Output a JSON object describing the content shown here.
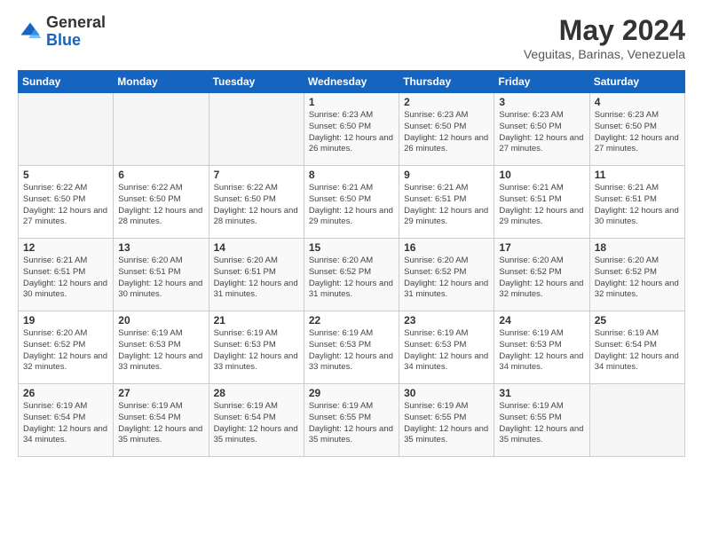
{
  "header": {
    "logo_general": "General",
    "logo_blue": "Blue",
    "title": "May 2024",
    "location": "Veguitas, Barinas, Venezuela"
  },
  "days_of_week": [
    "Sunday",
    "Monday",
    "Tuesday",
    "Wednesday",
    "Thursday",
    "Friday",
    "Saturday"
  ],
  "weeks": [
    [
      {
        "day": "",
        "info": ""
      },
      {
        "day": "",
        "info": ""
      },
      {
        "day": "",
        "info": ""
      },
      {
        "day": "1",
        "info": "Sunrise: 6:23 AM\nSunset: 6:50 PM\nDaylight: 12 hours\nand 26 minutes."
      },
      {
        "day": "2",
        "info": "Sunrise: 6:23 AM\nSunset: 6:50 PM\nDaylight: 12 hours\nand 26 minutes."
      },
      {
        "day": "3",
        "info": "Sunrise: 6:23 AM\nSunset: 6:50 PM\nDaylight: 12 hours\nand 27 minutes."
      },
      {
        "day": "4",
        "info": "Sunrise: 6:23 AM\nSunset: 6:50 PM\nDaylight: 12 hours\nand 27 minutes."
      }
    ],
    [
      {
        "day": "5",
        "info": "Sunrise: 6:22 AM\nSunset: 6:50 PM\nDaylight: 12 hours\nand 27 minutes."
      },
      {
        "day": "6",
        "info": "Sunrise: 6:22 AM\nSunset: 6:50 PM\nDaylight: 12 hours\nand 28 minutes."
      },
      {
        "day": "7",
        "info": "Sunrise: 6:22 AM\nSunset: 6:50 PM\nDaylight: 12 hours\nand 28 minutes."
      },
      {
        "day": "8",
        "info": "Sunrise: 6:21 AM\nSunset: 6:50 PM\nDaylight: 12 hours\nand 29 minutes."
      },
      {
        "day": "9",
        "info": "Sunrise: 6:21 AM\nSunset: 6:51 PM\nDaylight: 12 hours\nand 29 minutes."
      },
      {
        "day": "10",
        "info": "Sunrise: 6:21 AM\nSunset: 6:51 PM\nDaylight: 12 hours\nand 29 minutes."
      },
      {
        "day": "11",
        "info": "Sunrise: 6:21 AM\nSunset: 6:51 PM\nDaylight: 12 hours\nand 30 minutes."
      }
    ],
    [
      {
        "day": "12",
        "info": "Sunrise: 6:21 AM\nSunset: 6:51 PM\nDaylight: 12 hours\nand 30 minutes."
      },
      {
        "day": "13",
        "info": "Sunrise: 6:20 AM\nSunset: 6:51 PM\nDaylight: 12 hours\nand 30 minutes."
      },
      {
        "day": "14",
        "info": "Sunrise: 6:20 AM\nSunset: 6:51 PM\nDaylight: 12 hours\nand 31 minutes."
      },
      {
        "day": "15",
        "info": "Sunrise: 6:20 AM\nSunset: 6:52 PM\nDaylight: 12 hours\nand 31 minutes."
      },
      {
        "day": "16",
        "info": "Sunrise: 6:20 AM\nSunset: 6:52 PM\nDaylight: 12 hours\nand 31 minutes."
      },
      {
        "day": "17",
        "info": "Sunrise: 6:20 AM\nSunset: 6:52 PM\nDaylight: 12 hours\nand 32 minutes."
      },
      {
        "day": "18",
        "info": "Sunrise: 6:20 AM\nSunset: 6:52 PM\nDaylight: 12 hours\nand 32 minutes."
      }
    ],
    [
      {
        "day": "19",
        "info": "Sunrise: 6:20 AM\nSunset: 6:52 PM\nDaylight: 12 hours\nand 32 minutes."
      },
      {
        "day": "20",
        "info": "Sunrise: 6:19 AM\nSunset: 6:53 PM\nDaylight: 12 hours\nand 33 minutes."
      },
      {
        "day": "21",
        "info": "Sunrise: 6:19 AM\nSunset: 6:53 PM\nDaylight: 12 hours\nand 33 minutes."
      },
      {
        "day": "22",
        "info": "Sunrise: 6:19 AM\nSunset: 6:53 PM\nDaylight: 12 hours\nand 33 minutes."
      },
      {
        "day": "23",
        "info": "Sunrise: 6:19 AM\nSunset: 6:53 PM\nDaylight: 12 hours\nand 34 minutes."
      },
      {
        "day": "24",
        "info": "Sunrise: 6:19 AM\nSunset: 6:53 PM\nDaylight: 12 hours\nand 34 minutes."
      },
      {
        "day": "25",
        "info": "Sunrise: 6:19 AM\nSunset: 6:54 PM\nDaylight: 12 hours\nand 34 minutes."
      }
    ],
    [
      {
        "day": "26",
        "info": "Sunrise: 6:19 AM\nSunset: 6:54 PM\nDaylight: 12 hours\nand 34 minutes."
      },
      {
        "day": "27",
        "info": "Sunrise: 6:19 AM\nSunset: 6:54 PM\nDaylight: 12 hours\nand 35 minutes."
      },
      {
        "day": "28",
        "info": "Sunrise: 6:19 AM\nSunset: 6:54 PM\nDaylight: 12 hours\nand 35 minutes."
      },
      {
        "day": "29",
        "info": "Sunrise: 6:19 AM\nSunset: 6:55 PM\nDaylight: 12 hours\nand 35 minutes."
      },
      {
        "day": "30",
        "info": "Sunrise: 6:19 AM\nSunset: 6:55 PM\nDaylight: 12 hours\nand 35 minutes."
      },
      {
        "day": "31",
        "info": "Sunrise: 6:19 AM\nSunset: 6:55 PM\nDaylight: 12 hours\nand 35 minutes."
      },
      {
        "day": "",
        "info": ""
      }
    ]
  ]
}
